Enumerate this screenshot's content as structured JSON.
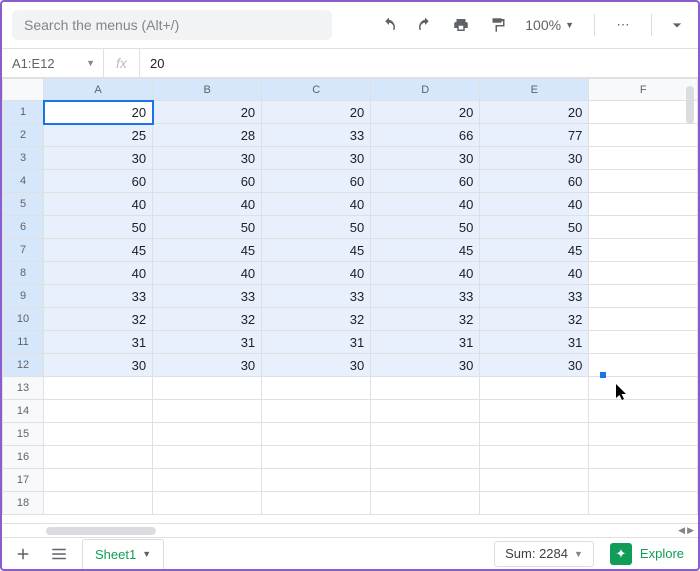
{
  "toolbar": {
    "search_placeholder": "Search the menus (Alt+/)",
    "zoom": "100%"
  },
  "formula_bar": {
    "range": "A1:E12",
    "fx_label": "fx",
    "value": "20"
  },
  "columns": [
    "A",
    "B",
    "C",
    "D",
    "E",
    "F"
  ],
  "rows_shown": 18,
  "selected_rows": 12,
  "selected_cols": 5,
  "cells": [
    [
      20,
      20,
      20,
      20,
      20
    ],
    [
      25,
      28,
      33,
      66,
      77
    ],
    [
      30,
      30,
      30,
      30,
      30
    ],
    [
      60,
      60,
      60,
      60,
      60
    ],
    [
      40,
      40,
      40,
      40,
      40
    ],
    [
      50,
      50,
      50,
      50,
      50
    ],
    [
      45,
      45,
      45,
      45,
      45
    ],
    [
      40,
      40,
      40,
      40,
      40
    ],
    [
      33,
      33,
      33,
      33,
      33
    ],
    [
      32,
      32,
      32,
      32,
      32
    ],
    [
      31,
      31,
      31,
      31,
      31
    ],
    [
      30,
      30,
      30,
      30,
      30
    ]
  ],
  "bottom": {
    "sheet_name": "Sheet1",
    "sum_label": "Sum: 2284",
    "explore_label": "Explore"
  }
}
